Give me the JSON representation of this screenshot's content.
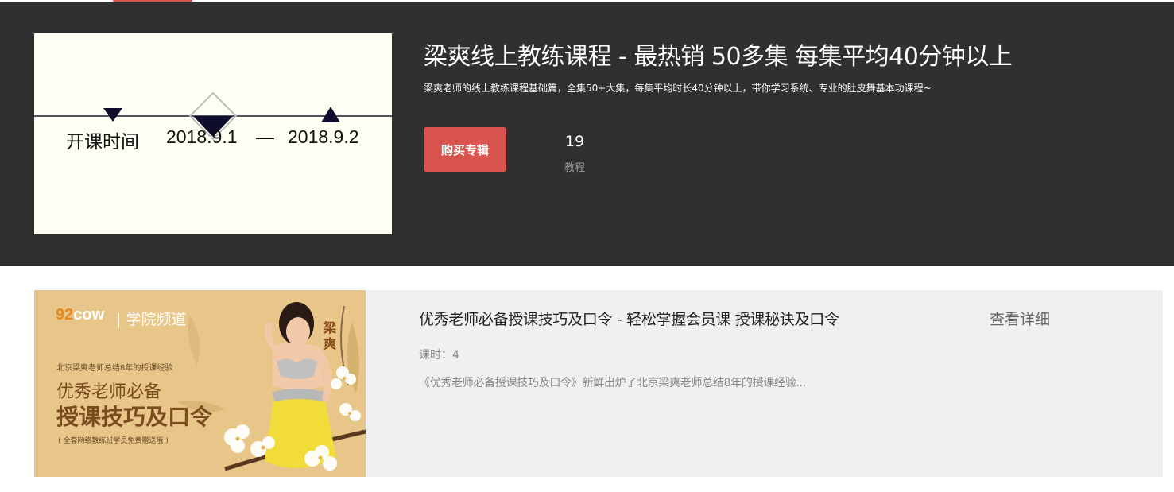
{
  "hero": {
    "title": "梁爽线上教练课程 - 最热销 50多集 每集平均40分钟以上",
    "description": "梁爽老师的线上教练课程基础篇，全集50+大集，每集平均时长40分钟以上，带你学习系统、专业的肚皮舞基本功课程~",
    "cover": {
      "label": "开课时间",
      "start_date": "2018.9.1",
      "dash": "—",
      "end_date": "2018.9.2"
    },
    "buy_button_label": "购买专辑",
    "tutorial_count": "19",
    "tutorial_label": "教程"
  },
  "course": {
    "title": "优秀老师必备授课技巧及口令 - 轻松掌握会员课 授课秘诀及口令",
    "lessons_label": "课时：4",
    "description": "《优秀老师必备授课技巧及口令》新鲜出炉了北京梁爽老师总结8年的授课经验...",
    "detail_link": "查看详细",
    "thumbnail": {
      "brand_num": "92",
      "brand_text": "cow",
      "channel": "| 学院频道",
      "subtitle": "北京梁爽老师总结8年的授课经验",
      "line1": "优秀老师必备",
      "line2": "授课技巧及口令",
      "note": "( 全套网络教练班学员免费赠送哦 )",
      "name_mark": "梁爽"
    }
  },
  "colors": {
    "hero_bg": "#2f302f",
    "accent": "#d9534f",
    "card_bg": "#f0f0f0",
    "cover_bg": "#fffef3"
  }
}
